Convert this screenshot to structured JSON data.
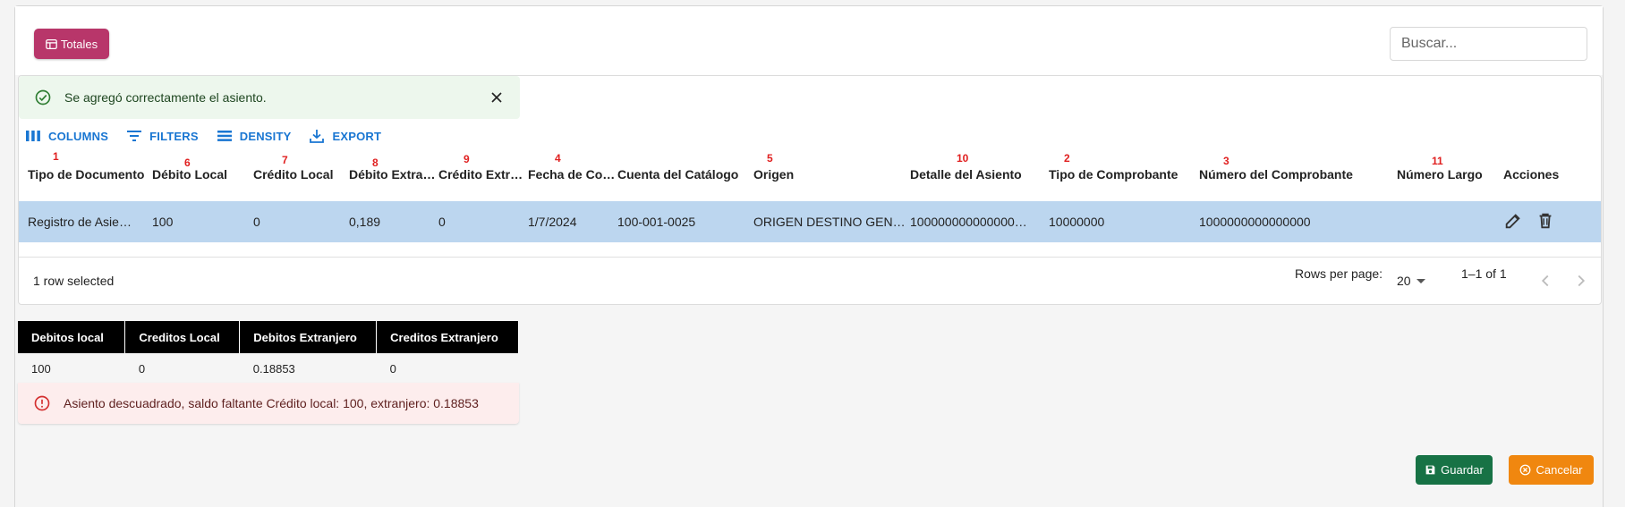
{
  "toolbar_top": {
    "totales_label": "Totales",
    "search_placeholder": "Buscar..."
  },
  "alert_success": {
    "message": "Se agregó correctamente el asiento."
  },
  "grid_toolbar": {
    "columns": "COLUMNS",
    "filters": "FILTERS",
    "density": "DENSITY",
    "export": "EXPORT"
  },
  "columns": [
    {
      "label": "Tipo de Documento",
      "marker": "1"
    },
    {
      "label": "Débito Local",
      "marker": "6"
    },
    {
      "label": "Crédito Local",
      "marker": "7"
    },
    {
      "label": "Débito Extra…",
      "marker": "8"
    },
    {
      "label": "Crédito Extr…",
      "marker": "9"
    },
    {
      "label": "Fecha de Co…",
      "marker": "4"
    },
    {
      "label": "Cuenta del Catálogo",
      "marker": ""
    },
    {
      "label": "Origen",
      "marker": "5"
    },
    {
      "label": "Detalle del Asiento",
      "marker": "10"
    },
    {
      "label": "Tipo de Comprobante",
      "marker": "2"
    },
    {
      "label": "Número del Comprobante",
      "marker": "3"
    },
    {
      "label": "Número Largo",
      "marker": "11"
    },
    {
      "label": "Acciones",
      "marker": ""
    }
  ],
  "rows": [
    {
      "cells": [
        "Registro de Asie…",
        "100",
        "0",
        "0,189",
        "0",
        "1/7/2024",
        "100-001-0025",
        "ORIGEN DESTINO GEN…",
        "100000000000000…",
        "10000000",
        "1000000000000000",
        ""
      ]
    }
  ],
  "footer": {
    "selected_text": "1 row selected",
    "rows_per_page_label": "Rows per page:",
    "rows_per_page_value": "20",
    "range_text": "1–1 of 1"
  },
  "totals": {
    "headers": [
      "Debitos local",
      "Creditos Local",
      "Debitos Extranjero",
      "Creditos Extranjero"
    ],
    "values": [
      "100",
      "0",
      "0.18853",
      "0"
    ]
  },
  "alert_error": {
    "message": "Asiento descuadrado, saldo faltante Crédito local: 100, extranjero: 0.18853"
  },
  "actions": {
    "save_label": "Guardar",
    "cancel_label": "Cancelar"
  },
  "colors": {
    "totales": "#b8366a",
    "selected_row": "#bcd6ef",
    "accent": "#1976d2",
    "save": "#177245",
    "cancel": "#f0870f",
    "marker": "#e02020"
  }
}
